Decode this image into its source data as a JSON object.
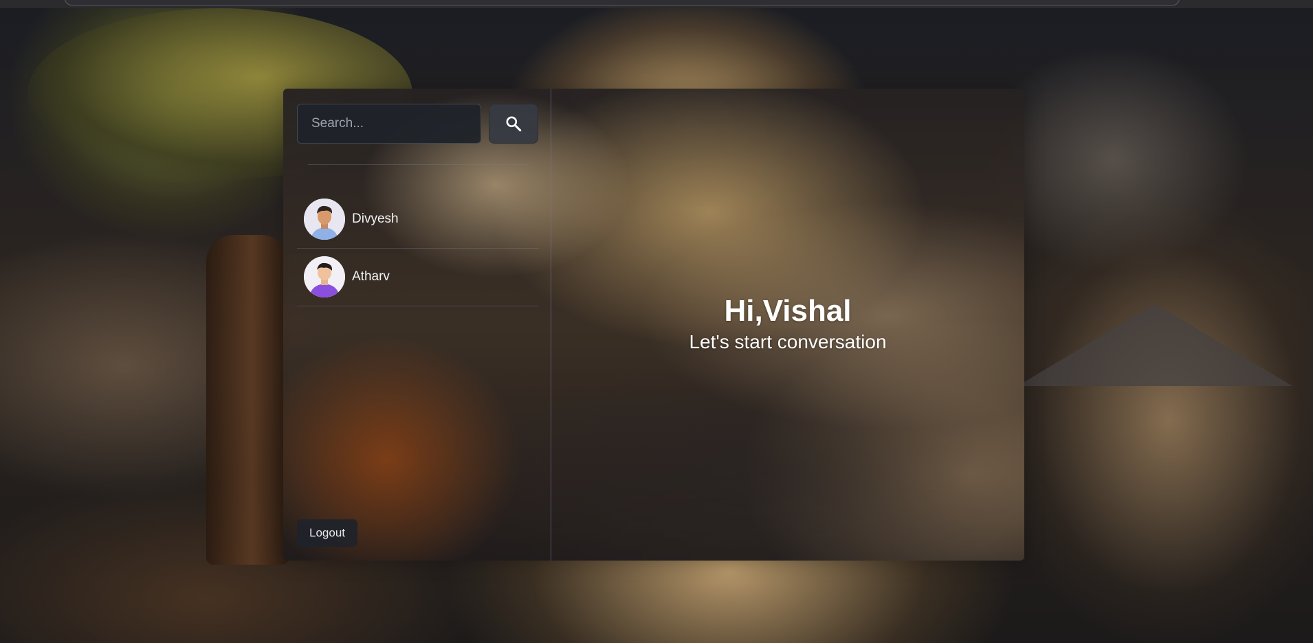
{
  "search": {
    "placeholder": "Search...",
    "button_icon": "search-icon"
  },
  "users": [
    {
      "name": "Divyesh",
      "avatar": "avatar-man-blue-shirt"
    },
    {
      "name": "Atharv",
      "avatar": "avatar-man-purple-shirt"
    }
  ],
  "sidebar": {
    "logout_label": "Logout"
  },
  "welcome": {
    "greeting": "Hi,Vishal",
    "subtitle": "Let's start conversation"
  },
  "colors": {
    "panel_dark": "#1f232a",
    "text_primary": "#ffffff",
    "divider": "#788cb0"
  }
}
